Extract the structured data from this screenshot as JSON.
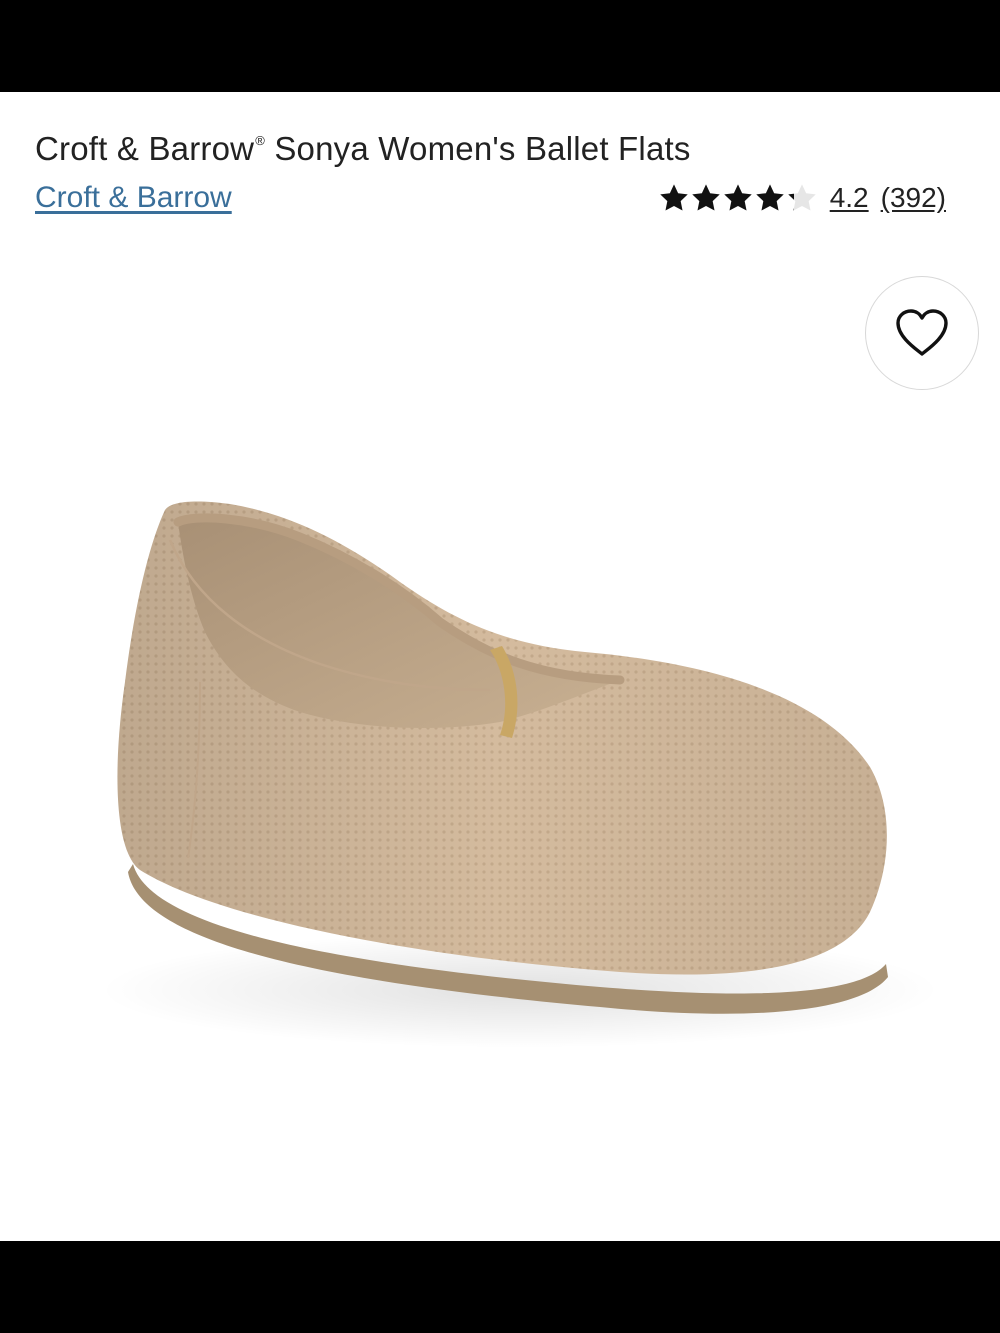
{
  "product": {
    "title_main": "Croft & Barrow",
    "title_registered": "®",
    "title_rest": " Sonya Women's Ballet Flats",
    "brand": "Croft & Barrow",
    "rating_value": "4.2",
    "rating": 4.2,
    "rating_max": 5,
    "review_count": "(392)",
    "image_subject": "beige knit ballet flat shoe"
  },
  "icons": {
    "favorite": "heart-outline-icon",
    "rating": "star-icon"
  },
  "colors": {
    "brand_link": "#3a6f9a",
    "text": "#222222",
    "shoe_knit": "#d2b89b",
    "sole": "#a69072"
  }
}
